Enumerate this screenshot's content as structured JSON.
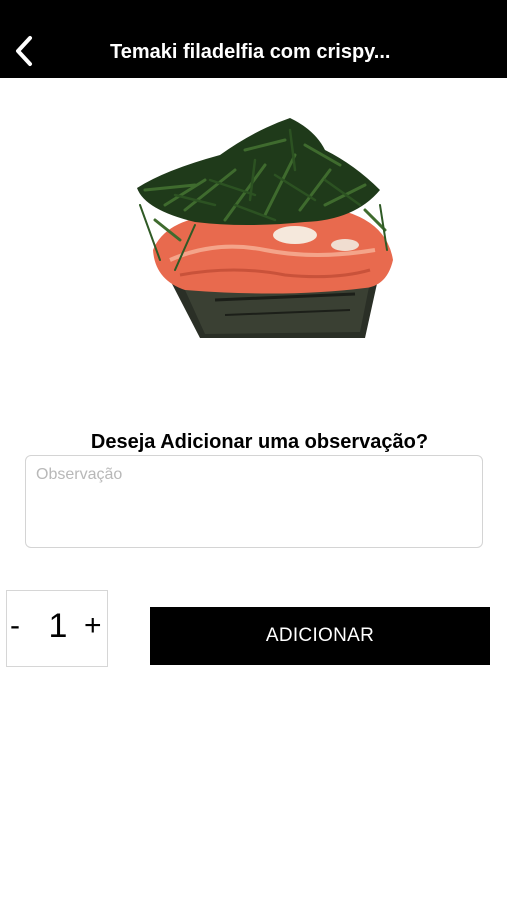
{
  "header": {
    "title": "Temaki filadelfia com crispy...",
    "back_icon": "chevron-left-icon"
  },
  "product": {
    "image_alt": ""
  },
  "observation": {
    "question": "Deseja Adicionar uma observação?",
    "placeholder": "Observação",
    "value": ""
  },
  "quantity": {
    "minus_label": "-",
    "value": "1",
    "plus_label": "+"
  },
  "actions": {
    "add_label": "ADICIONAR"
  },
  "colors": {
    "header_bg": "#000000",
    "button_bg": "#000000",
    "button_text": "#ffffff"
  }
}
